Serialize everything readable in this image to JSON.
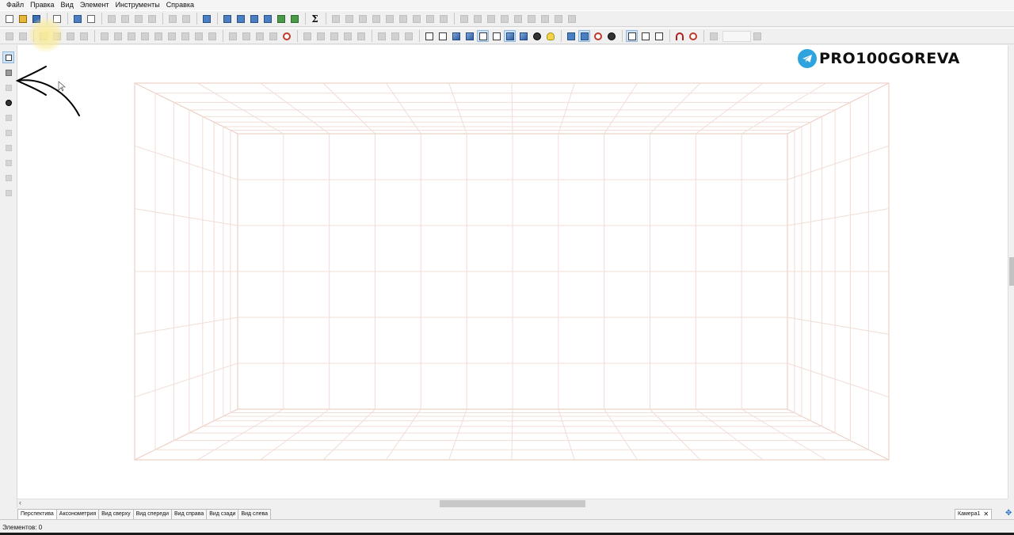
{
  "menu": {
    "items": [
      "Файл",
      "Правка",
      "Вид",
      "Элемент",
      "Инструменты",
      "Справка"
    ]
  },
  "toolbar_top": {
    "icons": [
      {
        "name": "new-doc-icon"
      },
      {
        "name": "open-folder-icon"
      },
      {
        "name": "save-icon"
      },
      {
        "sep": true
      },
      {
        "name": "export-icon"
      },
      {
        "sep": true
      },
      {
        "name": "print-icon"
      },
      {
        "name": "print-preview-icon"
      },
      {
        "sep": true
      },
      {
        "name": "cut-icon",
        "dim": true
      },
      {
        "name": "copy-icon",
        "dim": true
      },
      {
        "name": "paste-icon",
        "dim": true
      },
      {
        "name": "delete-icon",
        "dim": true
      },
      {
        "sep": true
      },
      {
        "name": "undo-icon",
        "dim": true
      },
      {
        "name": "redo-icon",
        "dim": true
      },
      {
        "sep": true
      },
      {
        "name": "properties-icon"
      },
      {
        "sep": true
      },
      {
        "name": "project-icon"
      },
      {
        "name": "order-icon"
      },
      {
        "name": "report-icon"
      },
      {
        "name": "parts-icon"
      },
      {
        "name": "price-icon"
      },
      {
        "name": "estimate-icon"
      },
      {
        "sep": true
      },
      {
        "name": "sigma-icon"
      },
      {
        "sep": true
      },
      {
        "name": "align-left-icon",
        "dim": true
      },
      {
        "name": "align-center-icon",
        "dim": true
      },
      {
        "name": "align-right-icon",
        "dim": true
      },
      {
        "name": "align-top-icon",
        "dim": true
      },
      {
        "name": "align-middle-icon",
        "dim": true
      },
      {
        "name": "align-bottom-icon",
        "dim": true
      },
      {
        "name": "distribute-h-icon",
        "dim": true
      },
      {
        "name": "distribute-v-icon",
        "dim": true
      },
      {
        "name": "distribute-d-icon",
        "dim": true
      },
      {
        "sep": true
      },
      {
        "name": "move-up-icon",
        "dim": true
      },
      {
        "name": "move-down-icon",
        "dim": true
      },
      {
        "name": "bring-front-icon",
        "dim": true
      },
      {
        "name": "send-back-icon",
        "dim": true
      },
      {
        "name": "group-icon",
        "dim": true
      },
      {
        "name": "ungroup-icon",
        "dim": true
      },
      {
        "name": "lock-icon",
        "dim": true
      },
      {
        "name": "unlock-icon",
        "dim": true
      },
      {
        "name": "hide-icon",
        "dim": true
      }
    ]
  },
  "toolbar_bottom": {
    "icons": [
      {
        "name": "snap-1-icon",
        "dim": true
      },
      {
        "name": "snap-2-icon",
        "dim": true
      },
      {
        "sep": true
      },
      {
        "name": "mirror-1-icon",
        "dim": true
      },
      {
        "name": "mirror-2-icon",
        "dim": true
      },
      {
        "name": "rotate-icon",
        "dim": true
      },
      {
        "name": "rotate-2-icon",
        "dim": true
      },
      {
        "sep": true
      },
      {
        "name": "grid-1-icon",
        "dim": true
      },
      {
        "name": "grid-2-icon",
        "dim": true
      },
      {
        "name": "arrow-up-icon",
        "dim": true
      },
      {
        "name": "arrow-down-icon",
        "dim": true
      },
      {
        "name": "arrow-left-icon",
        "dim": true
      },
      {
        "name": "move-icon",
        "dim": true
      },
      {
        "name": "scale-icon",
        "dim": true
      },
      {
        "name": "resize-icon",
        "dim": true
      },
      {
        "name": "flip-icon",
        "dim": true
      },
      {
        "sep": true
      },
      {
        "name": "oval-1-icon",
        "dim": true
      },
      {
        "name": "oval-2-icon",
        "dim": true
      },
      {
        "name": "eye-dim-icon",
        "dim": true
      },
      {
        "name": "eye-dim-2-icon",
        "dim": true
      },
      {
        "name": "target-icon"
      },
      {
        "sep": true
      },
      {
        "name": "hline-icon",
        "dim": true
      },
      {
        "name": "hline-2-icon",
        "dim": true
      },
      {
        "name": "hline-3-icon",
        "dim": true
      },
      {
        "name": "vline-icon",
        "dim": true
      },
      {
        "name": "vline-2-icon",
        "dim": true
      },
      {
        "sep": true
      },
      {
        "name": "orbit-icon",
        "dim": true
      },
      {
        "name": "orbit-2-icon",
        "dim": true
      },
      {
        "name": "orbit-3-icon",
        "dim": true
      },
      {
        "sep": true
      },
      {
        "name": "wireframe-icon"
      },
      {
        "name": "box-front-icon"
      },
      {
        "name": "box-solid-icon"
      },
      {
        "name": "box-blue-icon"
      },
      {
        "name": "box-outline-icon",
        "active": true
      },
      {
        "name": "box-outline-2-icon"
      },
      {
        "name": "box-blue-2-icon",
        "active": true
      },
      {
        "name": "materials-icon"
      },
      {
        "name": "light-icon"
      },
      {
        "name": "bulb-icon"
      },
      {
        "sep": true
      },
      {
        "name": "dimensions-icon"
      },
      {
        "name": "ruler-icon",
        "active": true
      },
      {
        "name": "grid-red-icon"
      },
      {
        "name": "eye-icon"
      },
      {
        "sep": true
      },
      {
        "name": "select-point-icon",
        "active": true
      },
      {
        "name": "select-edge-icon"
      },
      {
        "name": "select-face-icon"
      },
      {
        "sep": true
      },
      {
        "name": "magnet-icon"
      },
      {
        "name": "no-snap-icon"
      },
      {
        "sep": true
      },
      {
        "name": "zoom-icon",
        "dim": true
      },
      {
        "combo": true
      },
      {
        "name": "zoom-fit-icon",
        "dim": true
      }
    ]
  },
  "left_toolbar": {
    "icons": [
      {
        "name": "pointer-icon",
        "active": true
      },
      {
        "name": "grid-edit-icon"
      },
      {
        "name": "measure-icon",
        "dim": true
      },
      {
        "name": "pipette-icon"
      },
      {
        "name": "rect-icon",
        "dim": true
      },
      {
        "name": "connect-icon",
        "dim": true
      },
      {
        "name": "edit-1-icon",
        "dim": true
      },
      {
        "name": "edit-2-icon",
        "dim": true
      },
      {
        "name": "edit-3-icon",
        "dim": true
      },
      {
        "name": "edit-4-icon",
        "dim": true
      }
    ]
  },
  "logo": {
    "text": "PRO100GOREVA",
    "icon": "telegram-icon"
  },
  "view_tabs": [
    "Перспектива",
    "Аксонометрия",
    "Вид сверху",
    "Вид спереди",
    "Вид справа",
    "Вид сзади",
    "Вид слева"
  ],
  "camera_tab": {
    "label": "Камера1",
    "close": "✕"
  },
  "statusbar": {
    "text": "Элементов: 0"
  },
  "colors": {
    "grid_line": "#f1ddd6",
    "grid_edge": "#ecd0c6",
    "accent": "#2ea3dd"
  }
}
